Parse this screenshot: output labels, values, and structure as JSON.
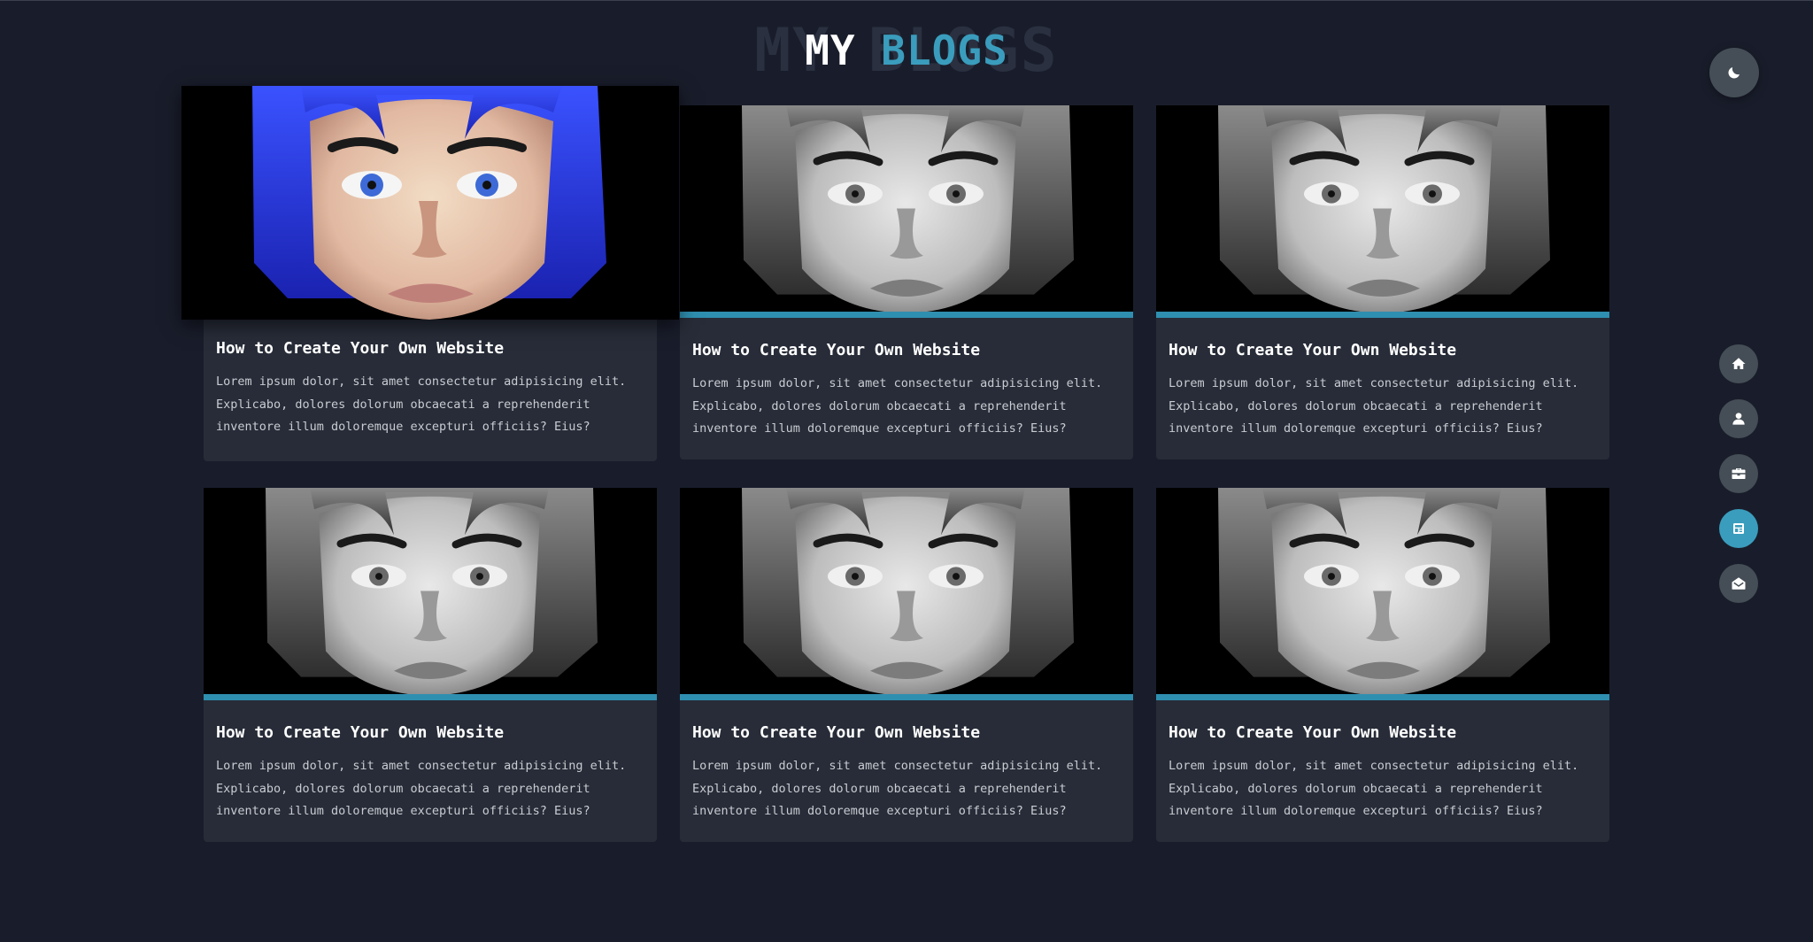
{
  "heading": {
    "background_text": "MY BLOGS",
    "word_main": "MY",
    "word_accent": "BLOGS"
  },
  "colors": {
    "background": "#191d2b",
    "card": "#272c38",
    "accent": "#3a9dbd",
    "button": "#454e56"
  },
  "theme_toggle": {
    "icon": "moon-icon"
  },
  "side_nav": {
    "items": [
      {
        "icon": "home-icon",
        "active": false
      },
      {
        "icon": "user-icon",
        "active": false
      },
      {
        "icon": "briefcase-icon",
        "active": false
      },
      {
        "icon": "blog-icon",
        "active": true
      },
      {
        "icon": "envelope-open-icon",
        "active": false
      }
    ]
  },
  "blogs": [
    {
      "title": "How to Create Your Own Website",
      "description": "Lorem ipsum dolor, sit amet consectetur adipisicing elit. Explicabo, dolores dolorum obcaecati a reprehenderit inventore illum doloremque excepturi officiis? Eius?",
      "image": "blue-haired-portrait"
    },
    {
      "title": "How to Create Your Own Website",
      "description": "Lorem ipsum dolor, sit amet consectetur adipisicing elit. Explicabo, dolores dolorum obcaecati a reprehenderit inventore illum doloremque excepturi officiis? Eius?",
      "image": "grayscale-portrait"
    },
    {
      "title": "How to Create Your Own Website",
      "description": "Lorem ipsum dolor, sit amet consectetur adipisicing elit. Explicabo, dolores dolorum obcaecati a reprehenderit inventore illum doloremque excepturi officiis? Eius?",
      "image": "grayscale-portrait"
    },
    {
      "title": "How to Create Your Own Website",
      "description": "Lorem ipsum dolor, sit amet consectetur adipisicing elit. Explicabo, dolores dolorum obcaecati a reprehenderit inventore illum doloremque excepturi officiis? Eius?",
      "image": "grayscale-portrait"
    },
    {
      "title": "How to Create Your Own Website",
      "description": "Lorem ipsum dolor, sit amet consectetur adipisicing elit. Explicabo, dolores dolorum obcaecati a reprehenderit inventore illum doloremque excepturi officiis? Eius?",
      "image": "grayscale-portrait"
    },
    {
      "title": "How to Create Your Own Website",
      "description": "Lorem ipsum dolor, sit amet consectetur adipisicing elit. Explicabo, dolores dolorum obcaecati a reprehenderit inventore illum doloremque excepturi officiis? Eius?",
      "image": "grayscale-portrait"
    }
  ]
}
